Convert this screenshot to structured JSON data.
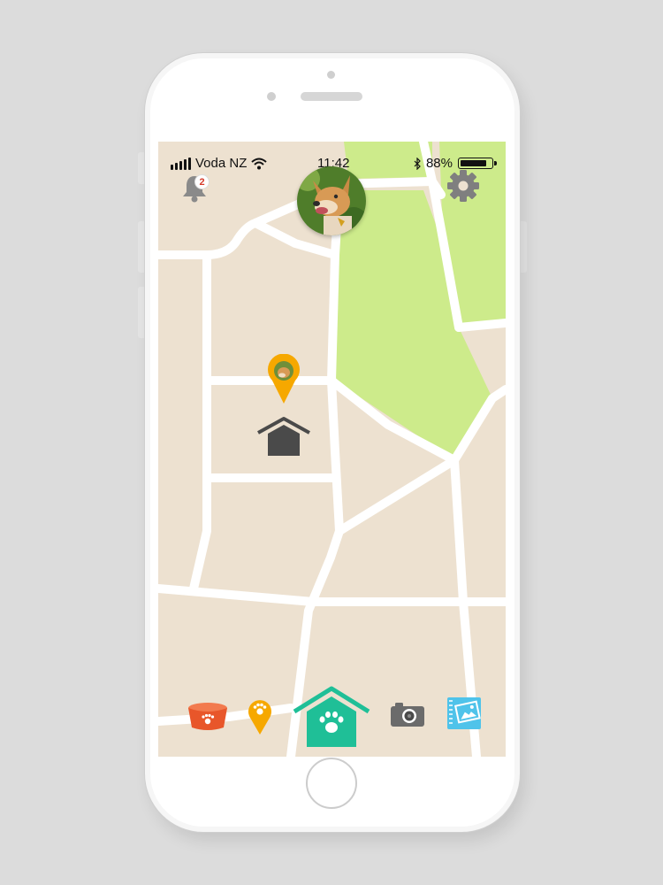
{
  "status_bar": {
    "carrier": "Voda NZ",
    "time": "11:42",
    "battery_percent": "88%",
    "battery_level": 0.88
  },
  "header": {
    "notification_count": "2",
    "profile_avatar": "dog-photo",
    "settings_icon": "gear-icon"
  },
  "map": {
    "land_color": "#ede1d0",
    "park_color": "#cdeb8b",
    "road_color": "#ffffff",
    "pet_location_pin_color": "#f6a800",
    "home_marker_color": "#4a4a4a"
  },
  "tab_bar": {
    "items": [
      {
        "name": "food-bowl",
        "icon": "bowl-icon",
        "color": "#e8562a"
      },
      {
        "name": "location",
        "icon": "paw-pin-icon",
        "color": "#f6a800"
      },
      {
        "name": "home",
        "icon": "paw-house-icon",
        "color": "#1fbf97",
        "active": true
      },
      {
        "name": "camera",
        "icon": "camera-icon",
        "color": "#6b6b6b"
      },
      {
        "name": "gallery",
        "icon": "photo-album-icon",
        "color": "#4fc3ea"
      }
    ]
  }
}
